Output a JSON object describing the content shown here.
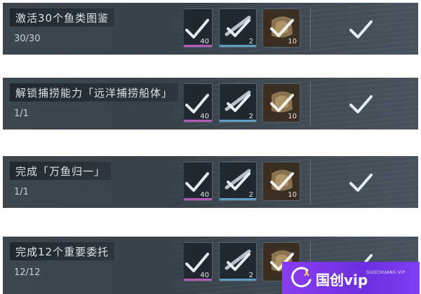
{
  "tasks": [
    {
      "title": "激活30个鱼类图鉴",
      "progress": "30/30",
      "reward1_qty": "40",
      "reward2_qty": "2",
      "reward3_qty": "10",
      "claimed": true
    },
    {
      "title": "解锁捕捞能力「远洋捕捞船体」",
      "progress": "1/1",
      "reward1_qty": "40",
      "reward2_qty": "2",
      "reward3_qty": "10",
      "claimed": true
    },
    {
      "title": "完成「万鱼归一」",
      "progress": "1/1",
      "reward1_qty": "40",
      "reward2_qty": "2",
      "reward3_qty": "10",
      "claimed": true
    },
    {
      "title": "完成12个重要委托",
      "progress": "12/12",
      "reward1_qty": "40",
      "reward2_qty": "2",
      "reward3_qty": "10",
      "claimed": true
    }
  ],
  "watermark": {
    "brand": "国创vip",
    "sub": "GUOCHUANG VIP"
  },
  "colors": {
    "row_bg": "#39434c",
    "check": "#e8eef3",
    "accent_purple": "#8a3cf0"
  },
  "icons": [
    "check-icon",
    "claimed-check-icon",
    "fishing-net-icon",
    "reward-shard-icon",
    "brand-logo-icon"
  ]
}
